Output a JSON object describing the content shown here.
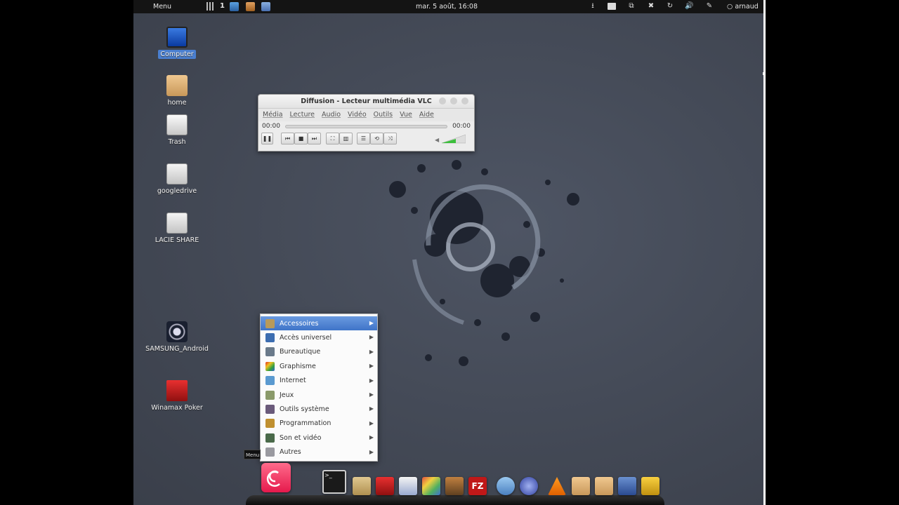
{
  "top_panel": {
    "menu_label": "Menu",
    "workspace_number": "1",
    "clock": "mar.  5 août, 16:08",
    "user": "arnaud"
  },
  "desktop_icons": [
    {
      "label": "Computer",
      "icon": "computer-icon",
      "selected": true
    },
    {
      "label": "home",
      "icon": "folder-icon"
    },
    {
      "label": "Trash",
      "icon": "trash-icon"
    },
    {
      "label": "googledrive",
      "icon": "drive-icon"
    },
    {
      "label": "LACIE SHARE",
      "icon": "drive-icon"
    },
    {
      "label": "SAMSUNG_Android",
      "icon": "device-icon"
    },
    {
      "label": "Winamax Poker",
      "icon": "poker-icon"
    }
  ],
  "vlc": {
    "title": "Diffusion - Lecteur multimédia VLC",
    "menus": [
      "Média",
      "Lecture",
      "Audio",
      "Vidéo",
      "Outils",
      "Vue",
      "Aide"
    ],
    "time_elapsed": "00:00",
    "time_total": "00:00"
  },
  "app_menu": {
    "items": [
      {
        "label": "Accessoires",
        "icon": "accessories-icon",
        "color": "#b89a5a"
      },
      {
        "label": "Accès universel",
        "icon": "accessibility-icon",
        "color": "#3c6db0"
      },
      {
        "label": "Bureautique",
        "icon": "office-icon",
        "color": "#6a7a8a"
      },
      {
        "label": "Graphisme",
        "icon": "graphics-icon",
        "color": "#d04030"
      },
      {
        "label": "Internet",
        "icon": "internet-icon",
        "color": "#5a9ad0"
      },
      {
        "label": "Jeux",
        "icon": "games-icon",
        "color": "#8a9a6a"
      },
      {
        "label": "Outils système",
        "icon": "system-tools-icon",
        "color": "#6a5a7a"
      },
      {
        "label": "Programmation",
        "icon": "programming-icon",
        "color": "#c09030"
      },
      {
        "label": "Son et vidéo",
        "icon": "sound-video-icon",
        "color": "#4a6a4a"
      },
      {
        "label": "Autres",
        "icon": "others-icon",
        "color": "#9a9aa0"
      }
    ]
  },
  "menu_tooltip": "Menu",
  "dock_items": [
    {
      "name": "debian-menu-icon"
    },
    {
      "name": "terminal-icon"
    },
    {
      "name": "archive-icon"
    },
    {
      "name": "poker-app-icon"
    },
    {
      "name": "text-editor-icon"
    },
    {
      "name": "image-viewer-icon"
    },
    {
      "name": "presentation-icon"
    },
    {
      "name": "filezilla-icon"
    },
    {
      "name": "network-icon"
    },
    {
      "name": "browser-icon"
    },
    {
      "name": "vlc-icon"
    },
    {
      "name": "folder-icon"
    },
    {
      "name": "folder-icon"
    },
    {
      "name": "virtualbox-icon"
    },
    {
      "name": "folder-add-icon"
    }
  ]
}
